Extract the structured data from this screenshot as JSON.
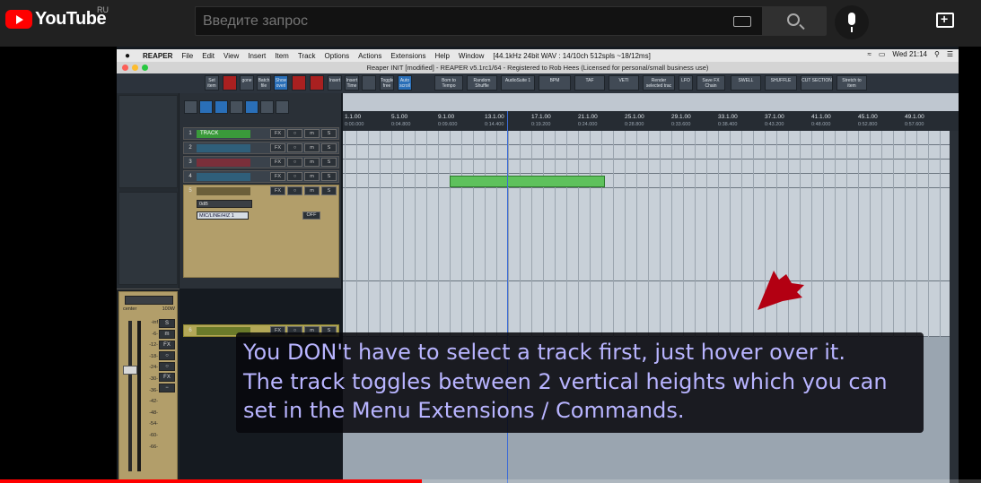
{
  "youtube": {
    "logo_text": "YouTube",
    "region": "RU",
    "search_placeholder": "Введите запрос"
  },
  "mac_menubar": {
    "app": "REAPER",
    "menus": [
      "File",
      "Edit",
      "View",
      "Insert",
      "Item",
      "Track",
      "Options",
      "Actions",
      "Extensions",
      "Help",
      "Window"
    ],
    "status": "[44.1kHz 24bit WAV : 14/10ch 512spls ~18/12ms]",
    "clock": "Wed 21:14"
  },
  "window_title": "Reaper INIT [modified] - REAPER v5.1rc1/64 - Registered to Rob Hees (Licensed for personal/small business use)",
  "toolbar_buttons": [
    "Set item",
    "",
    "gone",
    "Batch file",
    "Show overl",
    "",
    "",
    "Insert",
    "Insert Time",
    "",
    "Toggle free",
    "Auto scroll",
    "Bom to Tempo",
    "Random Shuffle",
    "AudioSuite 1",
    "BPM",
    "TAF",
    "VETI",
    "Render selected trac",
    "LFO",
    "Save FX Chain",
    "SWELL",
    "SHUFFLE",
    "CUT SECTION",
    "Stretch to item"
  ],
  "tracks": [
    {
      "num": "1",
      "name": "TRACK",
      "color": "#3a9a3a"
    },
    {
      "num": "2",
      "name": "",
      "color": "#2f5f7a"
    },
    {
      "num": "3",
      "name": "",
      "color": "#7a2f3a"
    },
    {
      "num": "4",
      "name": "",
      "color": "#2f5f7a"
    },
    {
      "num": "5",
      "name": "",
      "color": "#8a7a4a"
    },
    {
      "num": "6",
      "name": "",
      "color": "#6a7a2a"
    }
  ],
  "track_controls": [
    "FX",
    "○",
    "m",
    "S"
  ],
  "track5_extra": {
    "volume_label": "0dB",
    "input": "MIC/LINE/HIZ 1",
    "monitor": "OFF"
  },
  "ruler": [
    {
      "bar": "1.1.00",
      "time": "0:00.000"
    },
    {
      "bar": "5.1.00",
      "time": "0:04.800"
    },
    {
      "bar": "9.1.00",
      "time": "0:09.600"
    },
    {
      "bar": "13.1.00",
      "time": "0:14.400"
    },
    {
      "bar": "17.1.00",
      "time": "0:19.200"
    },
    {
      "bar": "21.1.00",
      "time": "0:24.000"
    },
    {
      "bar": "25.1.00",
      "time": "0:28.800"
    },
    {
      "bar": "29.1.00",
      "time": "0:33.600"
    },
    {
      "bar": "33.1.00",
      "time": "0:38.400"
    },
    {
      "bar": "37.1.00",
      "time": "0:43.200"
    },
    {
      "bar": "41.1.00",
      "time": "0:48.000"
    },
    {
      "bar": "45.1.00",
      "time": "0:52.800"
    },
    {
      "bar": "49.1.00",
      "time": "0:57.600"
    }
  ],
  "mixer": {
    "pan_left": "center",
    "pan_right": "100W",
    "db_scale": [
      "-inf",
      "-6-",
      "-12-",
      "-18-",
      "-24-",
      "-30-",
      "-36-",
      "-42-",
      "-48-",
      "-54-",
      "-60-",
      "-66-"
    ],
    "buttons": [
      "S",
      "m",
      "FX",
      "○",
      "○",
      "FX",
      "−"
    ]
  },
  "caption": [
    "You DON't have to select a track first, just hover over it.",
    "The track toggles between 2 vertical heights which you can",
    "set in the Menu Extensions / Commands."
  ],
  "progress": {
    "played_fraction": 0.43,
    "color": "#ff0000"
  }
}
